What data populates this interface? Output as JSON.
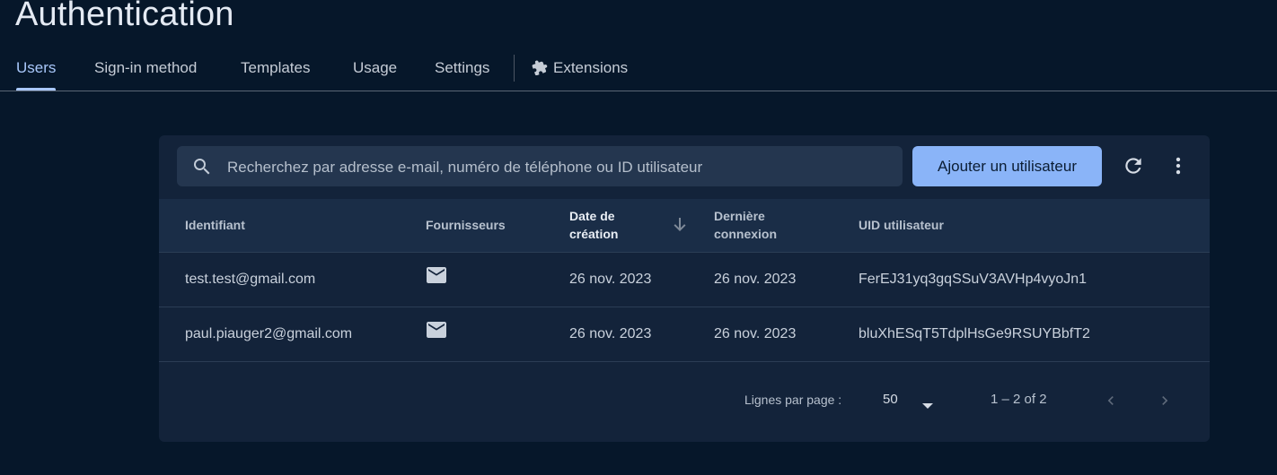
{
  "page": {
    "title": "Authentication"
  },
  "tabs": [
    {
      "label": "Users",
      "active": true
    },
    {
      "label": "Sign-in method"
    },
    {
      "label": "Templates"
    },
    {
      "label": "Usage"
    },
    {
      "label": "Settings"
    },
    {
      "label": "Extensions",
      "icon": "puzzle-icon"
    }
  ],
  "toolbar": {
    "search_placeholder": "Recherchez par adresse e-mail, numéro de téléphone ou ID utilisateur",
    "search_value": "",
    "add_user_label": "Ajouter un utilisateur",
    "refresh_icon": "refresh-icon",
    "more_icon": "more-vert-icon"
  },
  "table": {
    "columns": {
      "identifier": "Identifiant",
      "providers": "Fournisseurs",
      "created_line1": "Date de",
      "created_line2": "création",
      "last_signin_line1": "Dernière",
      "last_signin_line2": "connexion",
      "uid": "UID utilisateur"
    },
    "sort": {
      "column": "created",
      "direction": "descending",
      "icon": "arrow-down-icon"
    },
    "rows": [
      {
        "identifier": "test.test@gmail.com",
        "provider_icon": "mail-icon",
        "created": "26 nov. 2023",
        "last_signin": "26 nov. 2023",
        "uid": "FerEJ31yq3gqSSuV3AVHp4vyoJn1"
      },
      {
        "identifier": "paul.piauger2@gmail.com",
        "provider_icon": "mail-icon",
        "created": "26 nov. 2023",
        "last_signin": "26 nov. 2023",
        "uid": "bluXhESqT5TdplHsGe9RSUYBbfT2"
      }
    ]
  },
  "pagination": {
    "rows_per_page_label": "Lignes par page :",
    "rows_per_page_value": "50",
    "range_label": "1 – 2 of 2"
  },
  "colors": {
    "background": "#06172a",
    "card": "#13233a",
    "accent": "#8ab4f8",
    "active_tab": "#a8c7fa"
  }
}
